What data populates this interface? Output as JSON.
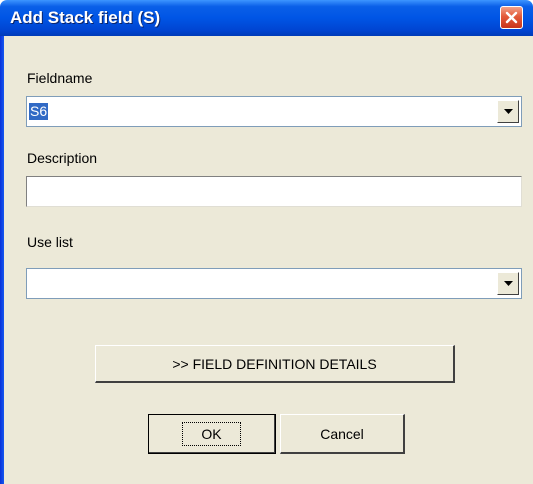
{
  "window": {
    "title": "Add Stack field (S)",
    "close_icon": "close-icon"
  },
  "form": {
    "fieldname": {
      "label": "Fieldname",
      "value": "S6"
    },
    "description": {
      "label": "Description",
      "value": ""
    },
    "use_list": {
      "label": "Use list",
      "value": ""
    }
  },
  "buttons": {
    "details": ">> FIELD DEFINITION DETAILS",
    "ok": "OK",
    "cancel": "Cancel"
  },
  "colors": {
    "titlebar": "#0055e5",
    "dialog_bg": "#ece9d8",
    "selection": "#316ac5",
    "close": "#e35a3a"
  }
}
